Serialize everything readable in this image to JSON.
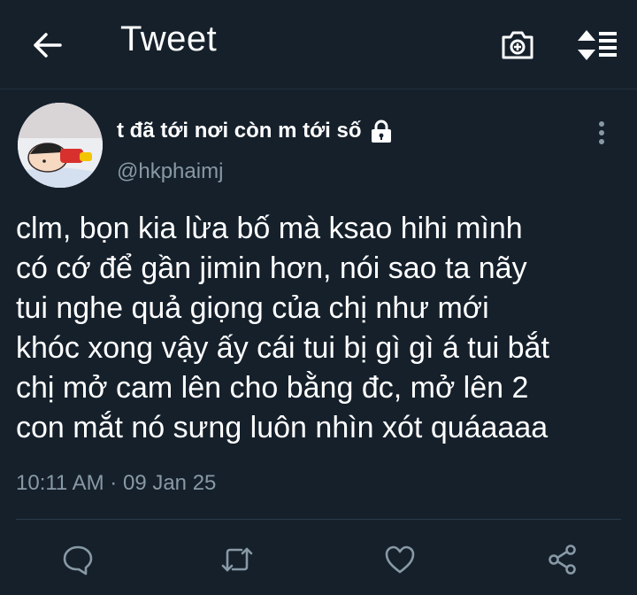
{
  "header": {
    "title": "Tweet",
    "icons": {
      "back": "arrow-left-icon",
      "camera": "camera-icon",
      "sort": "sort-icon"
    }
  },
  "tweet": {
    "display_name": "t đã tới nơi còn m tới số",
    "handle": "@hkphaimj",
    "text": "clm, bọn kia lừa bố mà ksao hihi mình\ncó cớ để gần jimin hơn, nói sao ta nãy\ntui nghe quả giọng của chị như mới\nkhóc xong vậy ấy cái tui bị gì gì á tui bắt\nchị mở cam lên cho bằng đc, mở lên 2\ncon mắt nó sưng luôn nhìn xót quáaaaa",
    "time": "10:11 AM",
    "separator": "·",
    "date": "09 Jan 25"
  },
  "actions": [
    "reply-icon",
    "retweet-icon",
    "like-icon",
    "share-icon"
  ],
  "colors": {
    "background": "#15202b",
    "secondary_text": "#8899a6",
    "divider": "#2a3a49",
    "text": "#ffffff"
  }
}
